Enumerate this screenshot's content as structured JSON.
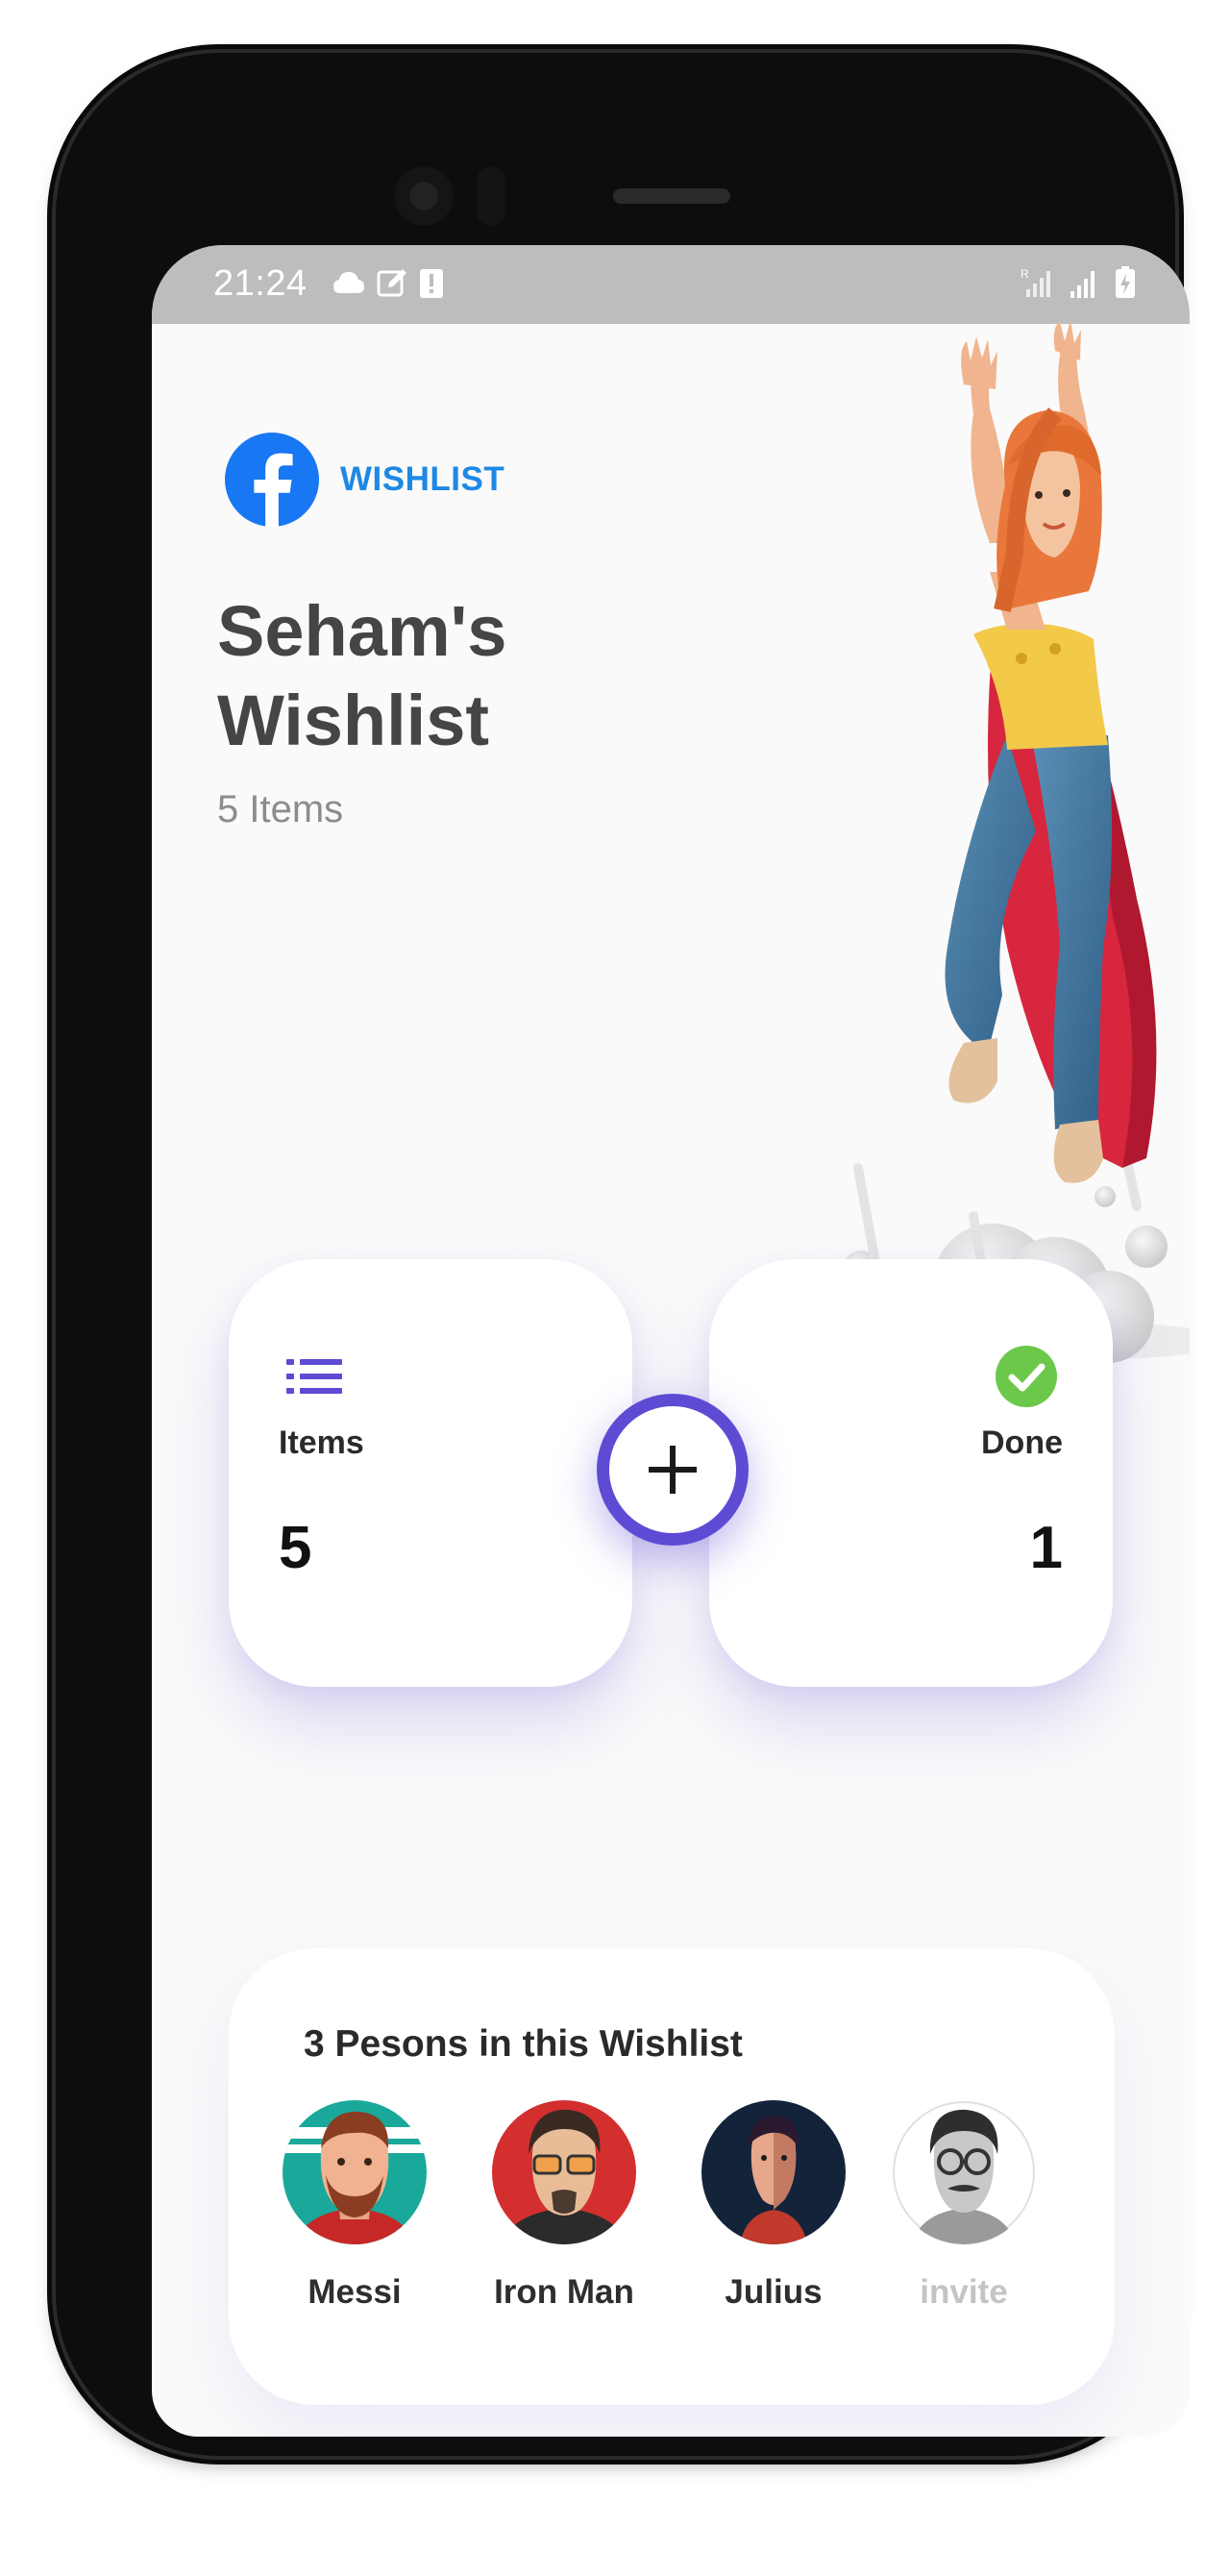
{
  "status_bar": {
    "time": "21:24"
  },
  "brand": {
    "name": "WISHLIST"
  },
  "wishlist": {
    "title_line1": "Seham's",
    "title_line2": "Wishlist",
    "subtitle": "5 Items"
  },
  "stats": {
    "items": {
      "label": "Items",
      "count": "5"
    },
    "done": {
      "label": "Done",
      "count": "1"
    }
  },
  "persons": {
    "title": "3 Pesons in this Wishlist",
    "list": [
      {
        "name": "Messi"
      },
      {
        "name": "Iron Man"
      },
      {
        "name": "Julius"
      },
      {
        "name": "invite"
      }
    ]
  },
  "colors": {
    "accent": "#5e4bd4",
    "brand": "#1e88e5",
    "success": "#6cc84a"
  }
}
